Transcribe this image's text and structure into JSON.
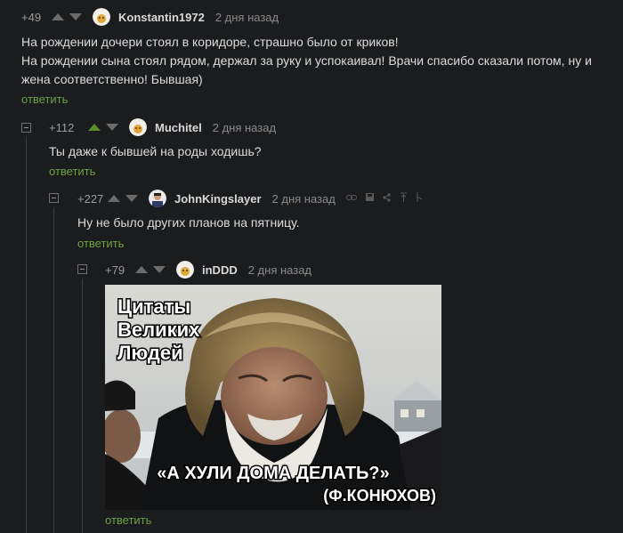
{
  "comments": [
    {
      "rating": "+49",
      "user": "Konstantin1972",
      "date": "2 дня назад",
      "lines": [
        "На рождении дочери стоял в коридоре, страшно было от криков!",
        "На рождении сына стоял рядом, держал за руку и успокаивал! Врачи спасибо сказали потом, ну и",
        "жена соответственно! Бывшая)"
      ],
      "reply": "ответить"
    },
    {
      "rating": "+112",
      "user": "Muchitel",
      "date": "2 дня назад",
      "lines": [
        "Ты даже к бывшей на роды ходишь?"
      ],
      "reply": "ответить"
    },
    {
      "rating": "+227",
      "user": "JohnKingslayer",
      "date": "2 дня назад",
      "lines": [
        "Ну не было других планов на пятницу."
      ],
      "reply": "ответить",
      "tool_icons": [
        "link-icon",
        "save-icon",
        "share-icon",
        "up-arrow-icon",
        "branch-icon"
      ]
    },
    {
      "rating": "+79",
      "user": "inDDD",
      "date": "2 дня назад",
      "reply": "ответить",
      "image": {
        "caption_top": [
          "Цитаты",
          "Великих",
          "Людей"
        ],
        "quote": "«А ХУЛИ ДОМА ДЕЛАТЬ?»",
        "author": "(Ф.КОНЮХОВ)"
      }
    }
  ],
  "colors": {
    "background": "#1b1c1e",
    "reply_link": "#6ea143",
    "vote_active": "#5c8f2b"
  }
}
